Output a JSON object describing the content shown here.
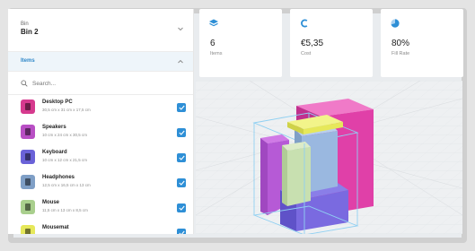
{
  "bin": {
    "caption": "Bin",
    "value": "Bin 2"
  },
  "items_section": {
    "label": "Items"
  },
  "search": {
    "placeholder": "Search..."
  },
  "items": [
    {
      "name": "Desktop PC",
      "dims": "30,5 cm x 31 cm x 17,5 cm",
      "color": "#d63a8e"
    },
    {
      "name": "Speakers",
      "dims": "10 cm x 24 cm x 30,5 cm",
      "color": "#b84fc4"
    },
    {
      "name": "Keyboard",
      "dims": "10 cm x 12 cm x 21,5 cm",
      "color": "#6a62d8"
    },
    {
      "name": "Headphones",
      "dims": "12,5 cm x 16,5 cm x 13 cm",
      "color": "#7f9fc6"
    },
    {
      "name": "Mouse",
      "dims": "11,5 cm x 13 cm x 8,5 cm",
      "color": "#a9cf8d"
    },
    {
      "name": "Mousemat",
      "dims": "",
      "color": "#e6e85a"
    }
  ],
  "stats": {
    "items": {
      "value": "6",
      "label": "Items"
    },
    "cost": {
      "value": "€5,35",
      "label": "Cost"
    },
    "fill": {
      "value": "80%",
      "label": "Fill Rate"
    }
  },
  "colors": {
    "accent": "#2e8fd6",
    "pink": "#e040a8",
    "purple": "#b65ad6",
    "violet": "#7a6ae0",
    "blue": "#9ab8e0",
    "green": "#c8e0b0",
    "yellow": "#eef07a"
  }
}
